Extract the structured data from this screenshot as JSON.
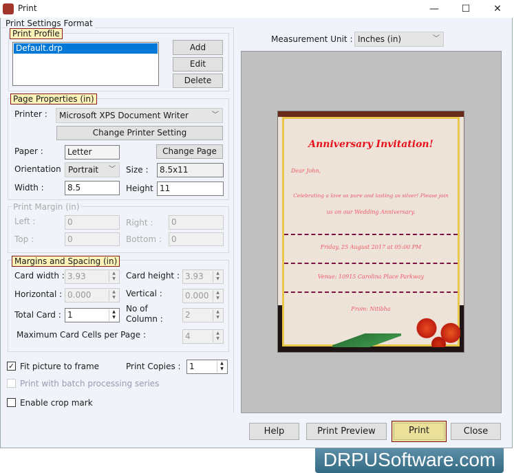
{
  "window": {
    "title": "Print",
    "minimize": "—",
    "maximize": "☐",
    "close": "✕"
  },
  "settings_group": "Print Settings Format",
  "print_profile": {
    "legend": "Print Profile",
    "items": [
      "Default.drp"
    ],
    "add": "Add",
    "edit": "Edit",
    "delete": "Delete"
  },
  "page_properties": {
    "legend": "Page Properties  (in)",
    "printer_label": "Printer :",
    "printer_value": "Microsoft XPS Document Writer",
    "change_printer": "Change Printer Setting",
    "paper_label": "Paper :",
    "paper_value": "Letter",
    "change_page": "Change Page",
    "orientation_label": "Orientation :",
    "orientation_value": "Portrait",
    "size_label": "Size :",
    "size_value": "8.5x11",
    "width_label": "Width :",
    "width_value": "8.5",
    "height_label": "Height :",
    "height_value": "11"
  },
  "print_margin": {
    "legend": "Print Margin (in)",
    "left_label": "Left :",
    "left_value": "0",
    "right_label": "Right :",
    "right_value": "0",
    "top_label": "Top :",
    "top_value": "0",
    "bottom_label": "Bottom :",
    "bottom_value": "0"
  },
  "margins_spacing": {
    "legend": "Margins and Spacing  (in)",
    "card_width_label": "Card width :",
    "card_width": "3.93",
    "card_height_label": "Card height :",
    "card_height": "3.93",
    "horizontal_label": "Horizontal :",
    "horizontal": "0.000",
    "vertical_label": "Vertical :",
    "vertical": "0.000",
    "total_card_label": "Total Card :",
    "total_card": "1",
    "columns_label_1": "No of",
    "columns_label_2": "Column :",
    "columns": "2",
    "max_cells_label": "Maximum Card Cells per Page :",
    "max_cells": "4"
  },
  "options": {
    "fit_label": "Fit picture to frame",
    "fit_checked": true,
    "copies_label": "Print Copies :",
    "copies": "1",
    "batch_label": "Print with batch processing series",
    "batch_checked": false,
    "crop_label": "Enable crop mark",
    "crop_checked": false
  },
  "measurement": {
    "label": "Measurement Unit :",
    "value": "Inches (in)"
  },
  "preview_card": {
    "title": "Anniversary Invitation!",
    "greeting": "Dear John,",
    "line1": "Celebrating a love as pure and lasting as silver! Please join",
    "line2": "us on our Wedding Anniversary.",
    "date": "Friday, 25 August 2017 at 05:00 PM",
    "venue": "Venue: 10915 Carolina Place Parkway",
    "from": "From: Nitibha"
  },
  "buttons": {
    "help": "Help",
    "preview": "Print Preview",
    "print": "Print",
    "close": "Close"
  },
  "watermark": "DRPUSoftware.com"
}
